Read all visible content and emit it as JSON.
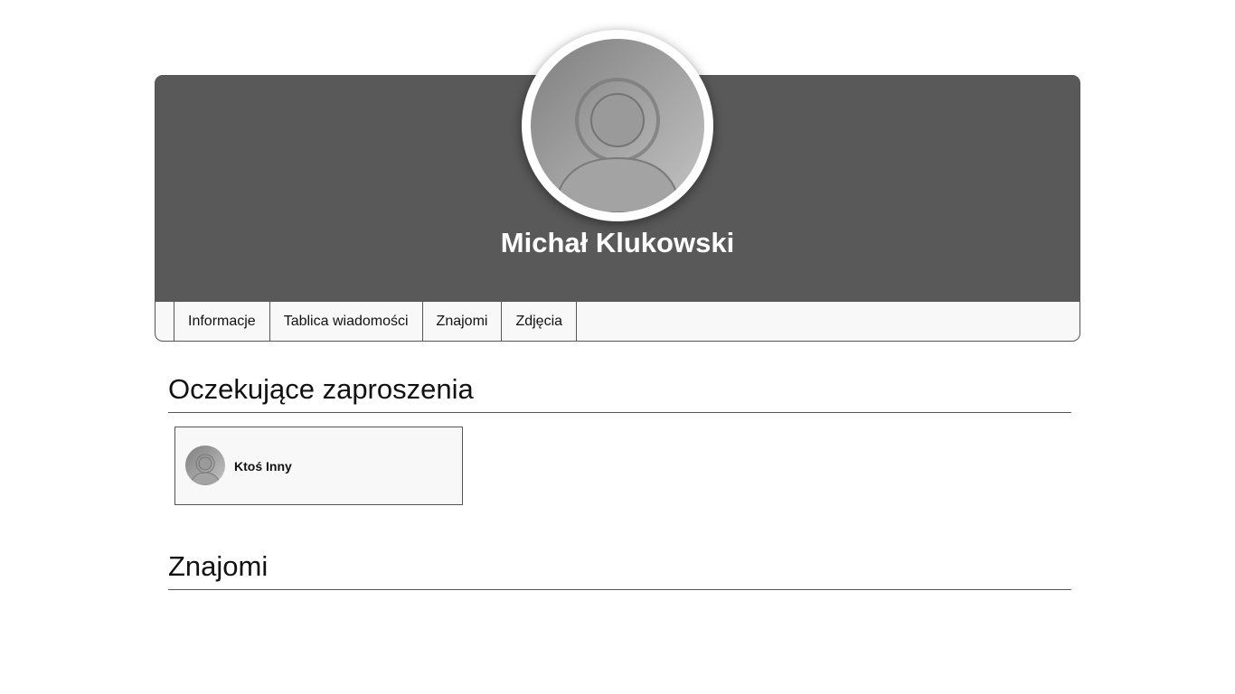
{
  "profile": {
    "name": "Michał Klukowski",
    "avatar_icon": "user-avatar-placeholder-icon"
  },
  "tabs": [
    {
      "label": "Informacje"
    },
    {
      "label": "Tablica wiadomości"
    },
    {
      "label": "Znajomi"
    },
    {
      "label": "Zdjęcia"
    }
  ],
  "sections": {
    "pending": {
      "title": "Oczekujące zaproszenia",
      "items": [
        {
          "name": "Ktoś Inny",
          "avatar_icon": "user-avatar-placeholder-icon"
        }
      ]
    },
    "friends": {
      "title": "Znajomi"
    }
  },
  "colors": {
    "banner": "#595959",
    "tabbar": "#f8f8f8",
    "border": "#555555",
    "name_text": "#ffffff"
  }
}
